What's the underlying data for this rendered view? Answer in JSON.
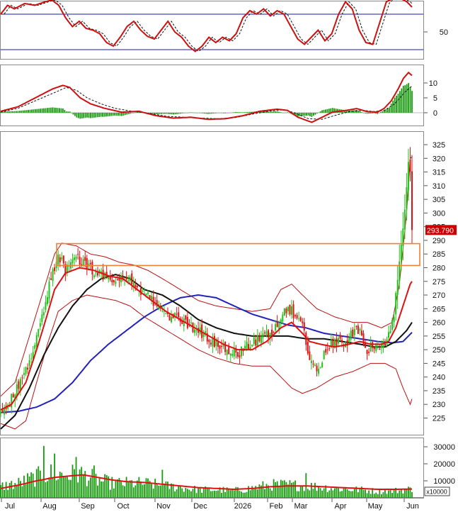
{
  "chart_data": {
    "type": "candlestick",
    "colors": {
      "up_candle": "#22c21a",
      "down_candle": "#e01010",
      "volume": "#1a9a10",
      "ma_red": "#dd1111",
      "ma_black": "#111111",
      "ma_blue": "#2222bb",
      "bollinger": "#bb1111",
      "signal_dashed": "#111111",
      "resistance_box": "#f08030",
      "price_tag_bg": "#cc0000",
      "price_tag_text": "#ffffff",
      "ref_line": "#1a1aa0"
    },
    "x_axis": {
      "month_labels": [
        "Jul",
        "Aug",
        "Sep",
        "Oct",
        "Nov",
        "Dec",
        "2026",
        "Feb",
        "Mar",
        "Apr",
        "May",
        "Jun"
      ]
    },
    "rsi_panel": {
      "tick_labels": [
        "50"
      ],
      "overbought_line": 70,
      "oversold_line": 30,
      "y_range": [
        10,
        90
      ]
    },
    "macd_panel": {
      "tick_labels": [
        "10",
        "5",
        "0"
      ],
      "y_range": [
        -5,
        16
      ]
    },
    "price_panel": {
      "tick_labels": [
        "325",
        "320",
        "315",
        "310",
        "305",
        "300",
        "295",
        "290",
        "285",
        "280",
        "275",
        "270",
        "265",
        "260",
        "255",
        "250",
        "245",
        "240",
        "235",
        "230",
        "225"
      ],
      "y_range": [
        220,
        328
      ],
      "last_price_label": "293.790",
      "last_price": 293.79,
      "resistance_zone": [
        280.8,
        288.8
      ]
    },
    "volume_panel": {
      "tick_labels": [
        "30000",
        "20000",
        "10000"
      ],
      "unit_label": "x10000",
      "y_range": [
        0,
        35000
      ]
    }
  }
}
